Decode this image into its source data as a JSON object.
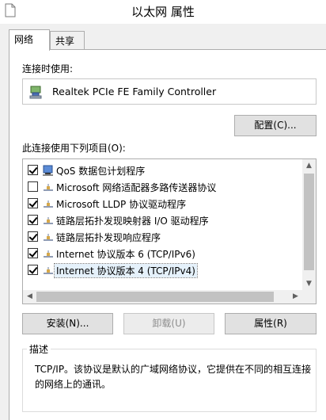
{
  "window": {
    "title": "以太网 属性"
  },
  "tabs": [
    {
      "label": "网络",
      "active": true
    },
    {
      "label": "共享",
      "active": false
    }
  ],
  "connect_using": {
    "label": "连接时使用:",
    "adapter": "Realtek PCIe FE Family Controller",
    "adapter_icon": "network-adapter-icon"
  },
  "buttons": {
    "configure": "配置(C)...",
    "install": "安装(N)...",
    "uninstall": "卸载(U)",
    "properties": "属性(R)"
  },
  "items_label": "此连接使用下列项目(O):",
  "items": [
    {
      "label": "QoS 数据包计划程序",
      "checked": true,
      "icon": "qos-icon"
    },
    {
      "label": "Microsoft 网络适配器多路传送器协议",
      "checked": false,
      "icon": "protocol-icon"
    },
    {
      "label": "Microsoft LLDP 协议驱动程序",
      "checked": true,
      "icon": "protocol-icon"
    },
    {
      "label": "链路层拓扑发现映射器 I/O 驱动程序",
      "checked": true,
      "icon": "protocol-icon"
    },
    {
      "label": "链路层拓扑发现响应程序",
      "checked": true,
      "icon": "protocol-icon"
    },
    {
      "label": "Internet 协议版本 6 (TCP/IPv6)",
      "checked": true,
      "icon": "protocol-icon"
    },
    {
      "label": "Internet 协议版本 4 (TCP/IPv4)",
      "checked": true,
      "icon": "protocol-icon",
      "selected": true
    }
  ],
  "description": {
    "title": "描述",
    "text": "TCP/IP。该协议是默认的广域网络协议，它提供在不同的相互连接的网络上的通讯。"
  },
  "colors": {
    "window_bg": "#f0f0f0",
    "panel_bg": "#ffffff",
    "selection": "#e5f1fb"
  }
}
